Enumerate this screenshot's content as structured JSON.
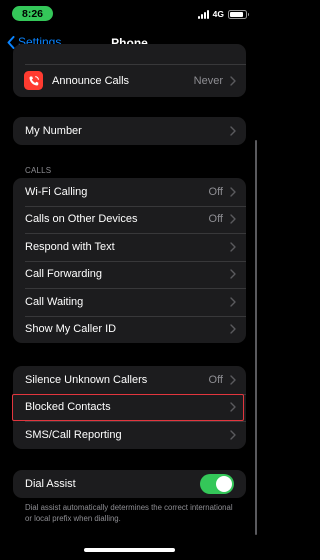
{
  "status": {
    "time": "8:26",
    "network": "4G",
    "battery_level": 0.85
  },
  "nav": {
    "back_label": "Settings",
    "title": "Phone"
  },
  "top_group": {
    "announce_label": "Announce Calls",
    "announce_value": "Never"
  },
  "number_group": {
    "my_number_label": "My Number"
  },
  "calls_section": {
    "header": "CALLS",
    "rows": [
      {
        "label": "Wi-Fi Calling",
        "value": "Off"
      },
      {
        "label": "Calls on Other Devices",
        "value": "Off"
      },
      {
        "label": "Respond with Text",
        "value": ""
      },
      {
        "label": "Call Forwarding",
        "value": ""
      },
      {
        "label": "Call Waiting",
        "value": ""
      },
      {
        "label": "Show My Caller ID",
        "value": ""
      }
    ]
  },
  "blocking_group": {
    "rows": [
      {
        "label": "Silence Unknown Callers",
        "value": "Off"
      },
      {
        "label": "Blocked Contacts",
        "value": ""
      },
      {
        "label": "SMS/Call Reporting",
        "value": ""
      }
    ]
  },
  "dial_assist": {
    "label": "Dial Assist",
    "enabled": true,
    "footer": "Dial assist automatically determines the correct international or local prefix when dialling."
  },
  "colors": {
    "accent_blue": "#0a84ff",
    "toggle_on": "#34c759",
    "icon_red": "#ff3b30",
    "highlight_red": "#e2363e",
    "cell_bg": "#1c1c1e"
  }
}
